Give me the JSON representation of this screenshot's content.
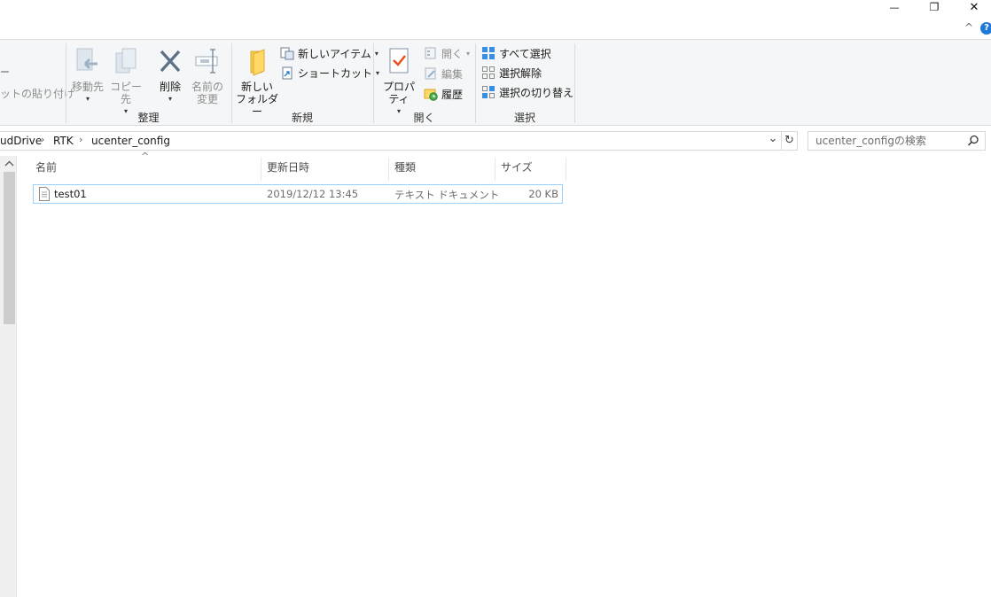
{
  "window": {
    "minimize_glyph": "—",
    "restore_glyph": "❐",
    "close_glyph": "✕",
    "help_glyph": "?",
    "ribbon_collapse_glyph": "^"
  },
  "ribbon": {
    "clipboard": {
      "partial_label_top": "ー",
      "partial_paste_shortcut": "ットの貼り付け"
    },
    "organize": {
      "label": "整理",
      "move_to": "移動先",
      "copy_to": "コピー先",
      "delete": "削除",
      "rename": "名前の\n変更"
    },
    "new": {
      "label": "新規",
      "new_folder": "新しい\nフォルダー",
      "new_item": "新しいアイテム",
      "shortcut": "ショートカット"
    },
    "open": {
      "label": "開く",
      "properties": "プロパティ",
      "open": "開く",
      "edit": "編集",
      "history": "履歴"
    },
    "select": {
      "label": "選択",
      "select_all": "すべて選択",
      "select_none": "選択解除",
      "invert": "選択の切り替え"
    }
  },
  "address": {
    "crumbs": [
      "udDrive",
      "RTK",
      "ucenter_config"
    ],
    "separator": "›",
    "dropdown_glyph": "⌄",
    "refresh_glyph": "↻"
  },
  "search": {
    "placeholder": "ucenter_configの検索"
  },
  "columns": {
    "name": "名前",
    "date": "更新日時",
    "type": "種類",
    "size": "サイズ",
    "sort_glyph": "^"
  },
  "files": [
    {
      "name": "test01",
      "date": "2019/12/12 13:45",
      "type": "テキスト ドキュメント",
      "size": "20 KB"
    }
  ],
  "colors": {
    "ribbon_bg": "#f5f6f7",
    "selection_border": "#99d1ff",
    "accent_blue": "#1e7ad6",
    "check_red": "#e84c1a"
  }
}
